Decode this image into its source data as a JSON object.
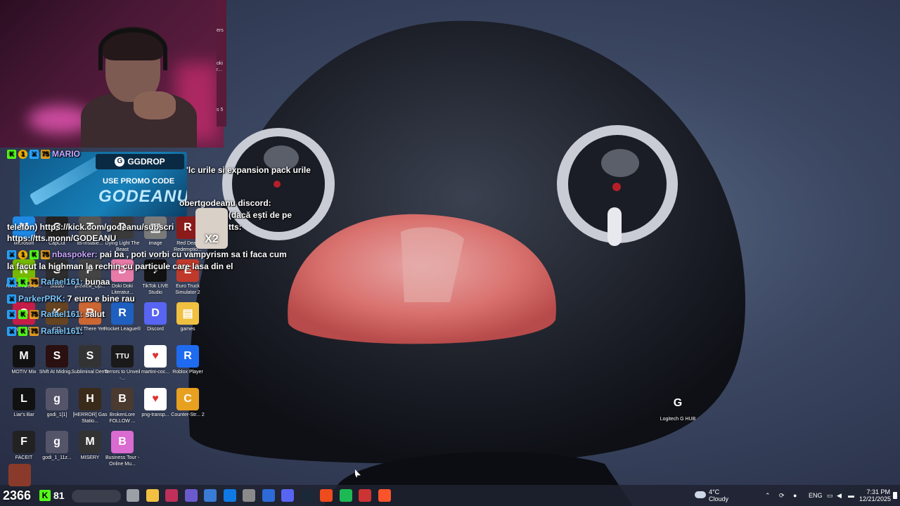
{
  "webcam": {
    "edge_labels": [
      "ers",
      "oki",
      "r...",
      "s 5"
    ]
  },
  "promo": {
    "brand": "GGDROP",
    "brand_glyph": "G",
    "line1": "USE PROMO CODE",
    "line2": "GODEANU"
  },
  "chat": {
    "lines": [
      {
        "user": "MARIO",
        "text": "",
        "badges": [
          "kick",
          "gold",
          "mod",
          "75"
        ]
      },
      {
        "user": "",
        "text": "'lc urile si expansion pack urile"
      },
      {
        "user": "",
        "text": "obertgodeanu discord:"
      },
      {
        "user": "",
        "text": "(dacă ești de pe"
      },
      {
        "user": "",
        "text": "telefon) https://kick.com/godeanu/subscri"
      },
      {
        "user": "",
        "text": "tts:"
      },
      {
        "user": "",
        "text": "https://tts.monn/GODEANU"
      },
      {
        "user": "nbaspoker:",
        "text": "pai ba , poti vorbi cu vampyrism sa ti faca cum"
      },
      {
        "user": "",
        "text": "la facut la highman la rechin cu particule care lasa din el"
      },
      {
        "user": "Rafael161:",
        "text": "bunaa"
      },
      {
        "user": "ParkerPRK:",
        "text": "7 euro e bine rau"
      },
      {
        "user": "Rafael161:",
        "text": "salut"
      },
      {
        "user": "Rafael161:",
        "text": ""
      }
    ],
    "emote_label": "X2"
  },
  "desktop_icons": [
    {
      "label": "Microsoft",
      "glyph": "M",
      "color": "#1e88e5"
    },
    {
      "label": "CapCut",
      "glyph": "C",
      "color": "#222222"
    },
    {
      "label": "tts-installe...",
      "glyph": "T",
      "color": "#555555"
    },
    {
      "label": "Dying Light The Beast",
      "glyph": "D",
      "color": "#3a3a3a"
    },
    {
      "label": "image",
      "glyph": "▣",
      "color": "#7a7a7a"
    },
    {
      "label": "Red Dead Redemptio...",
      "glyph": "R",
      "color": "#8b1a1a"
    },
    {
      "label": "NVIDIA GeFor...",
      "glyph": "N",
      "color": "#76b900"
    },
    {
      "label": "Studio",
      "glyph": "S",
      "color": "#2d2d2d"
    },
    {
      "label": "preview_Op...",
      "glyph": "P",
      "color": "#444444"
    },
    {
      "label": "Doki Doki Literatur...",
      "glyph": "D",
      "color": "#e87aa8"
    },
    {
      "label": "TikTok LIVE Studio",
      "glyph": "♪",
      "color": "#111111"
    },
    {
      "label": "Euro Truck Simulator 2",
      "glyph": "E",
      "color": "#c0392b"
    },
    {
      "label": "Opera GX",
      "glyph": "O",
      "color": "#c61c48"
    },
    {
      "label": "KO",
      "glyph": "K",
      "color": "#664422"
    },
    {
      "label": "RV There Yet",
      "glyph": "R",
      "color": "#cc6633"
    },
    {
      "label": "Rocket League®",
      "glyph": "R",
      "color": "#1f5fbf"
    },
    {
      "label": "Discord",
      "glyph": "D",
      "color": "#5865f2"
    },
    {
      "label": "games",
      "glyph": "▤",
      "color": "#f0c040"
    },
    {
      "label": "MOTIV Mix",
      "glyph": "M",
      "color": "#111111"
    },
    {
      "label": "Shift At Midnig...",
      "glyph": "S",
      "color": "#2a1010"
    },
    {
      "label": "Subliminal Demo",
      "glyph": "S",
      "color": "#333333"
    },
    {
      "label": "Terrors to Unveil -...",
      "glyph": "TTU",
      "color": "#1a1a1a"
    },
    {
      "label": "martini-coc...",
      "glyph": "♥",
      "color": "#ffffff"
    },
    {
      "label": "Roblox Player",
      "glyph": "R",
      "color": "#1e6bf0"
    },
    {
      "label": "Liar's Bar",
      "glyph": "L",
      "color": "#111111"
    },
    {
      "label": "godi_1[1]",
      "glyph": "g",
      "color": "#55556a"
    },
    {
      "label": "[HERROR] Gas Statio...",
      "glyph": "H",
      "color": "#3a2a1a"
    },
    {
      "label": "BrokenLore FOLLOW ...",
      "glyph": "B",
      "color": "#4a3a30"
    },
    {
      "label": "png-transp...",
      "glyph": "♥",
      "color": "#ffffff"
    },
    {
      "label": "Counter-Str... 2",
      "glyph": "C",
      "color": "#e8a020"
    },
    {
      "label": "FACEIT",
      "glyph": "F",
      "color": "#222222"
    },
    {
      "label": "godi_1_11z...",
      "glyph": "g",
      "color": "#55556a"
    },
    {
      "label": "MISERY",
      "glyph": "M",
      "color": "#333333"
    },
    {
      "label": "Business Tour - Online Mu...",
      "glyph": "B",
      "color": "#d96bd1"
    },
    {
      "label": "Logitech G HUB",
      "glyph": "G",
      "color": "transparent"
    }
  ],
  "taskbar": {
    "counter": "2366",
    "kick_count": "81",
    "kick_glyph": "K",
    "weather_temp": "4°C",
    "weather_desc": "Cloudy",
    "language": "ENG",
    "time": "7:31 PM",
    "date": "12/21/2025",
    "app_colors": [
      "#9aa0a6",
      "#f3c142",
      "#c0305a",
      "#6a5acd",
      "#3a7bd5",
      "#0f7ae5",
      "#8a8a8a",
      "#2d6bd6",
      "#5865f2",
      "#1b2838",
      "#ee4c1c",
      "#1db954",
      "#cc3333",
      "#fb542b"
    ]
  }
}
